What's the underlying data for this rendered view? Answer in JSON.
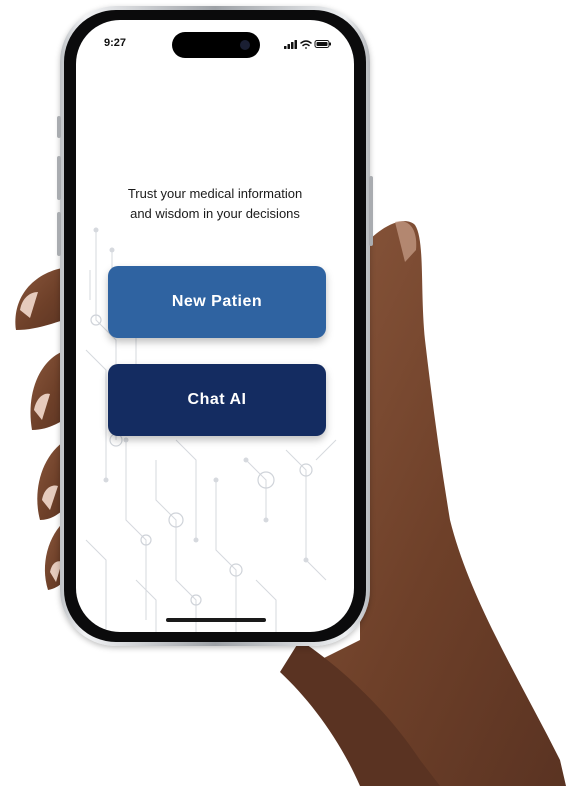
{
  "status_bar": {
    "time": "9:27",
    "icons": [
      "signal-icon",
      "wifi-icon",
      "battery-icon"
    ]
  },
  "screen": {
    "headline_line1": "Trust your medical information",
    "headline_line2": "and wisdom in your decisions",
    "new_patient_label": "New Patien",
    "chat_ai_label": "Chat AI"
  },
  "colors": {
    "new_patient_button": "#2f63a1",
    "chat_ai_button": "#142c61",
    "skin": "#7a4a32"
  }
}
